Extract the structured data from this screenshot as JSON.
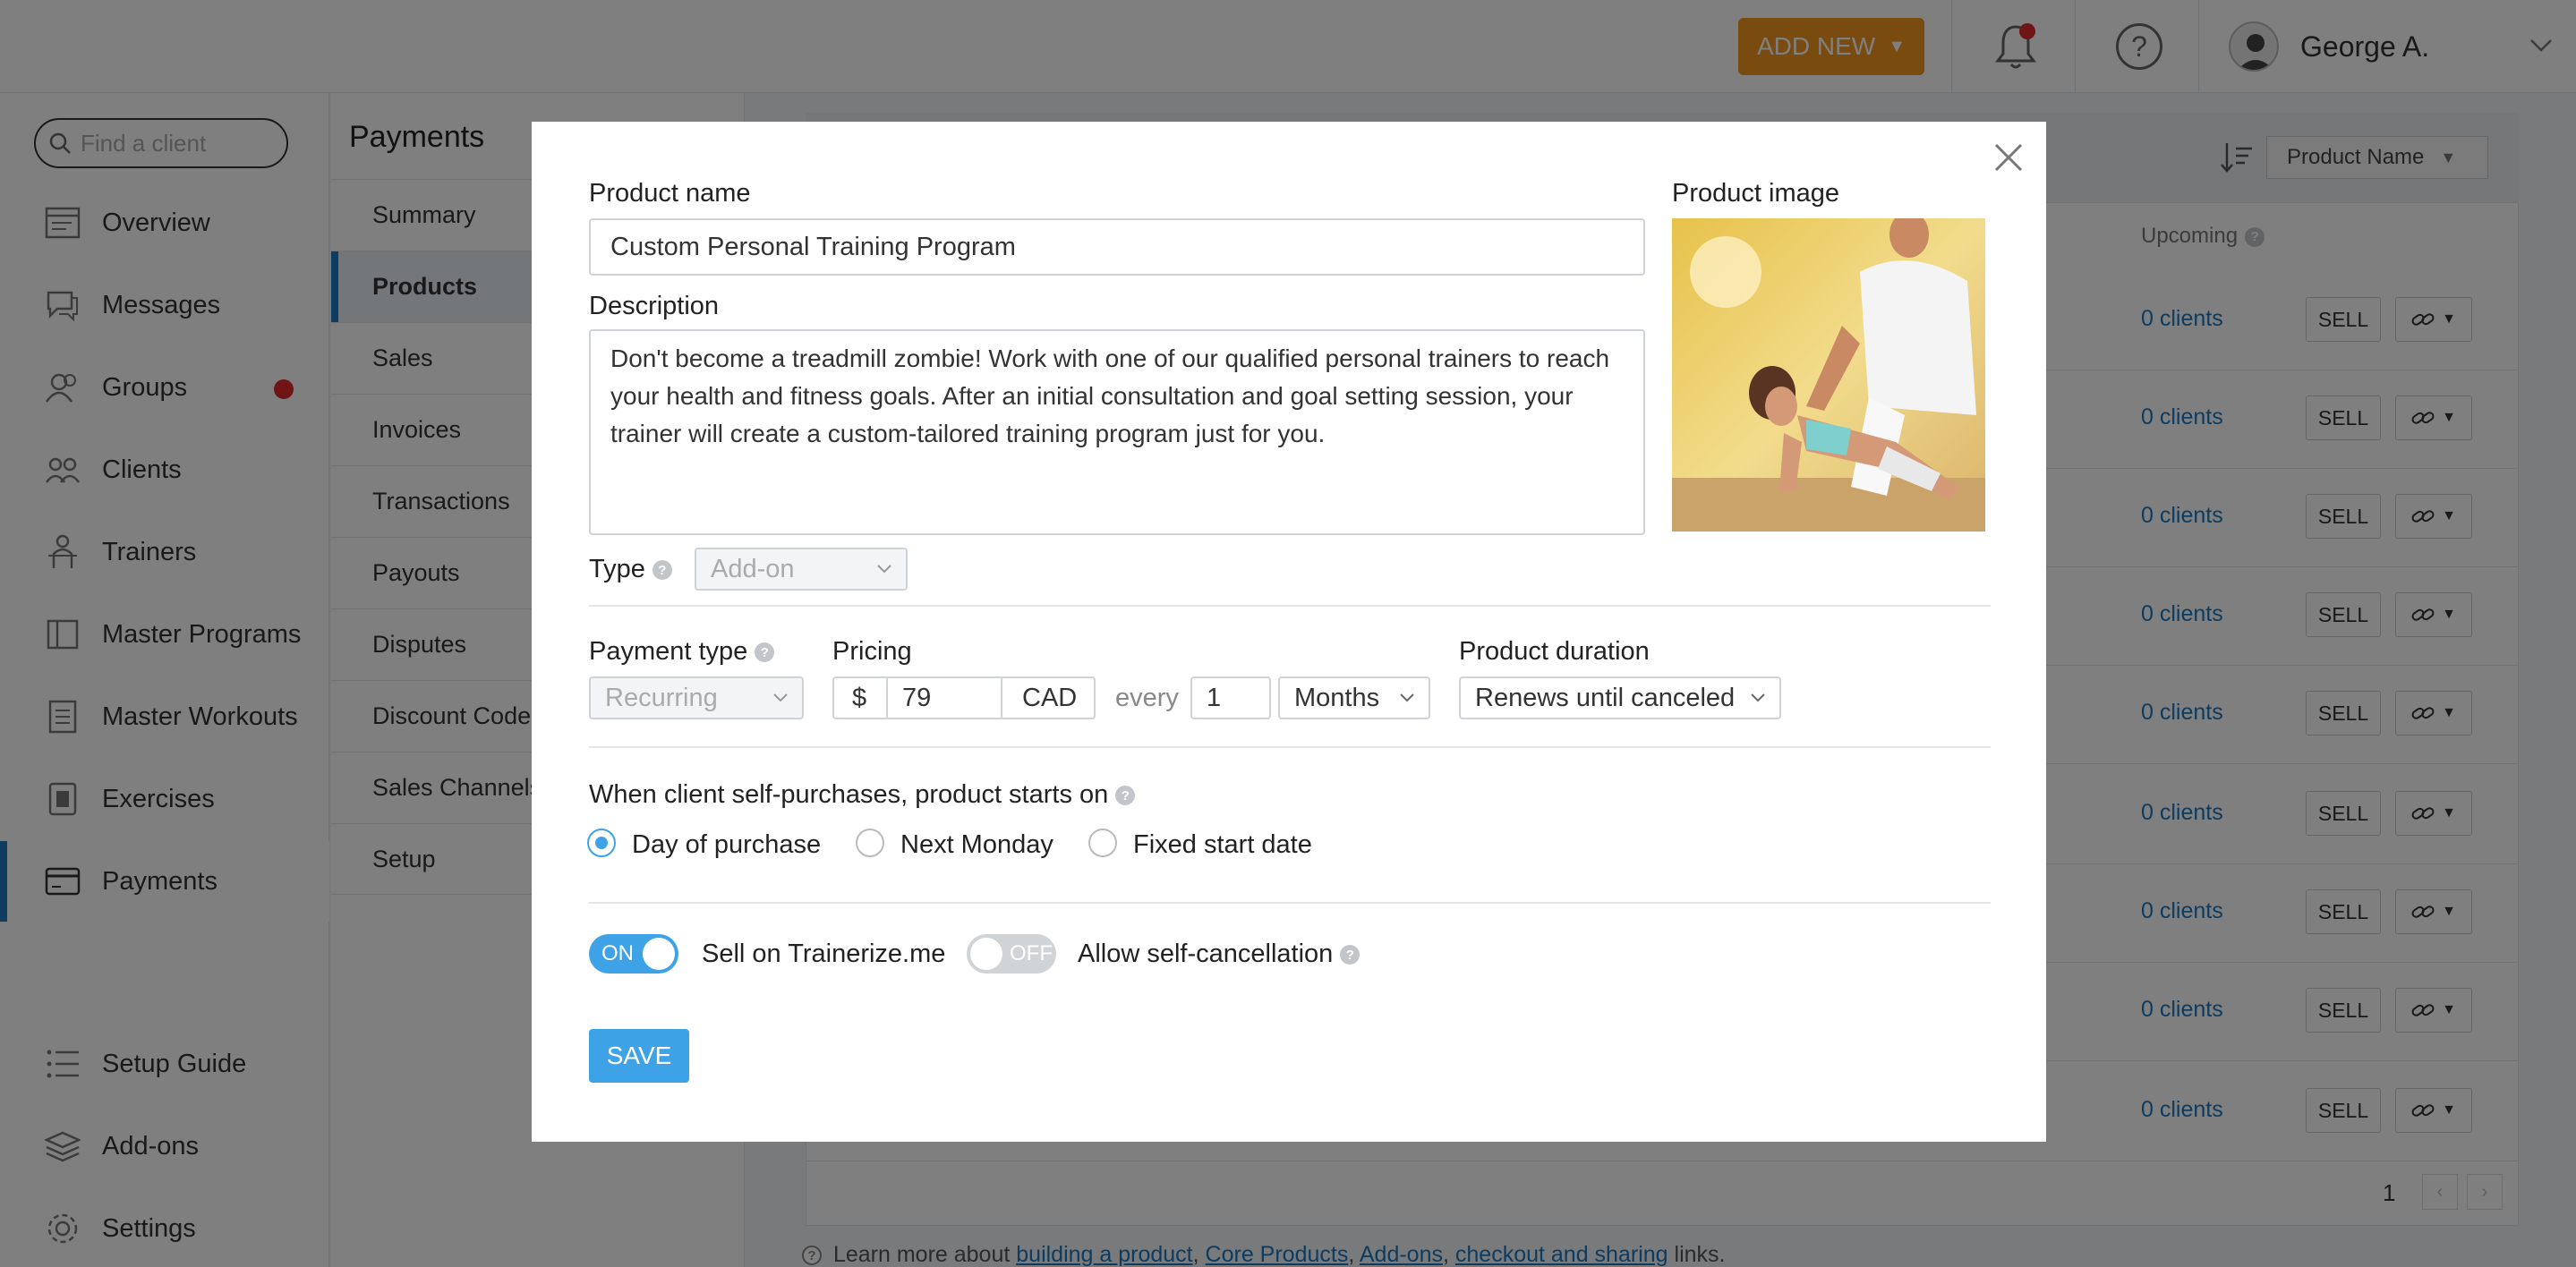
{
  "topbar": {
    "add_new": "ADD NEW",
    "add_new_caret": "▼",
    "user_name": "George A."
  },
  "sidebar": {
    "search_placeholder": "Find a client",
    "items": [
      {
        "label": "Overview"
      },
      {
        "label": "Messages"
      },
      {
        "label": "Groups"
      },
      {
        "label": "Clients"
      },
      {
        "label": "Trainers"
      },
      {
        "label": "Master Programs"
      },
      {
        "label": "Master Workouts"
      },
      {
        "label": "Exercises"
      },
      {
        "label": "Payments"
      },
      {
        "label": "Setup Guide"
      },
      {
        "label": "Add-ons"
      },
      {
        "label": "Settings"
      }
    ]
  },
  "subnav": {
    "title": "Payments",
    "items": [
      "Summary",
      "Products",
      "Sales",
      "Invoices",
      "Transactions",
      "Payouts",
      "Disputes",
      "Discount Codes",
      "Sales Channels",
      "Setup"
    ]
  },
  "table": {
    "sort_label": "Product Name",
    "upcoming_label": "Upcoming",
    "row_clients": "0 clients",
    "row_frag": "s",
    "sell_label": "SELL",
    "page": "1"
  },
  "footnote": {
    "prefix": "Learn more about",
    "link1": "building a product",
    "link2": "Core Products",
    "link3": "Add-ons",
    "link4": "checkout and sharing",
    "suffix": "links."
  },
  "modal": {
    "product_name_label": "Product name",
    "product_name_value": "Custom Personal Training Program",
    "description_label": "Description",
    "description_value": "Don't become a treadmill zombie! Work with one of our qualified personal trainers to reach your health and fitness goals. After an initial consultation and goal setting session, your trainer will create a custom-tailored training program just for you.",
    "product_image_label": "Product image",
    "type_label": "Type",
    "type_value": "Add-on",
    "payment_type_label": "Payment type",
    "payment_type_value": "Recurring",
    "pricing_label": "Pricing",
    "currency_symbol": "$",
    "price_value": "79",
    "currency_code": "CAD",
    "every_label": "every",
    "interval_value": "1",
    "interval_unit": "Months",
    "duration_label": "Product duration",
    "duration_value": "Renews until canceled",
    "start_label": "When client self-purchases, product starts on",
    "start_options": [
      "Day of purchase",
      "Next Monday",
      "Fixed start date"
    ],
    "start_selected": "Day of purchase",
    "toggle_on_text": "ON",
    "sell_on_label": "Sell on Trainerize.me",
    "toggle_off_text": "OFF",
    "self_cancel_label": "Allow self-cancellation",
    "save_label": "SAVE"
  },
  "colors": {
    "accent": "#3ea3e6",
    "add_new": "#f3961c",
    "link": "#1c78c0",
    "alert": "#e02b2b"
  }
}
